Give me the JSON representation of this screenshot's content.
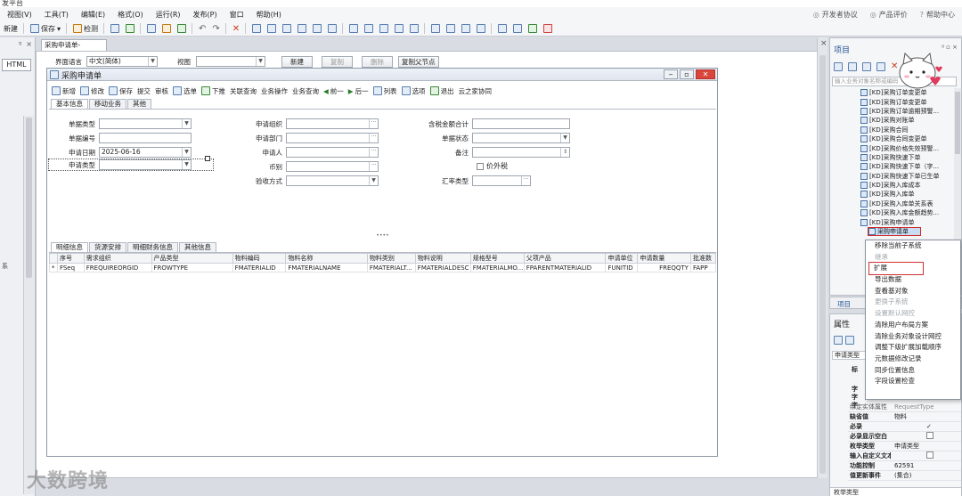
{
  "window": {
    "title": "发平台"
  },
  "menubar": {
    "items": [
      "视图(V)",
      "工具(T)",
      "编辑(E)",
      "格式(O)",
      "运行(R)",
      "发布(P)",
      "窗口",
      "帮助(H)"
    ],
    "right": [
      "开发者协议",
      "产品评价",
      "帮助中心"
    ]
  },
  "toolbar": {
    "new_label": "新建",
    "save_label": "保存",
    "check_label": "检测"
  },
  "leftpanel": {
    "pin": "ᵍ",
    "close": "×",
    "html_tab": "HTML",
    "side_label": "系"
  },
  "doc": {
    "tab_label": "采购申请单-_Default",
    "lang_label": "界面语言",
    "lang_value": "中文(简体)",
    "view_label": "视图",
    "view_value": "",
    "buttons": [
      "新建",
      "复制",
      "删除",
      "复制父节点"
    ]
  },
  "designer": {
    "title": "采购申请单",
    "toolbar": [
      "新增",
      "修改",
      "保存",
      "提交",
      "审核",
      "选单",
      "下推",
      "关联查询",
      "业务操作",
      "业务查询",
      "前一",
      "后一",
      "列表",
      "选项",
      "退出",
      "云之家协同"
    ],
    "head_tabs": [
      "基本信息",
      "移动业务",
      "其他"
    ],
    "col1": [
      {
        "label": "单据类型",
        "value": ""
      },
      {
        "label": "单据编号",
        "value": ""
      },
      {
        "label": "申请日期",
        "value": "2025-06-16"
      },
      {
        "label": "申请类型",
        "value": ""
      }
    ],
    "col2": [
      {
        "label": "申请组织",
        "value": ""
      },
      {
        "label": "申请部门",
        "value": ""
      },
      {
        "label": "申请人",
        "value": ""
      },
      {
        "label": "币别",
        "value": ""
      },
      {
        "label": "验收方式",
        "value": ""
      }
    ],
    "col3": [
      {
        "label": "含税金额合计",
        "value": ""
      },
      {
        "label": "单据状态",
        "value": ""
      },
      {
        "label": "备注",
        "value": ""
      },
      {
        "label": "价外税",
        "value": ""
      },
      {
        "label": "汇率类型",
        "value": ""
      }
    ],
    "splitter": "••••",
    "detail_tabs": [
      "明细信息",
      "货源安排",
      "明细财务信息",
      "其他信息"
    ],
    "grid": {
      "headers": [
        "序号",
        "需求组织",
        "产品类型",
        "物料编码",
        "物料名称",
        "物料类别",
        "物料说明",
        "规格型号",
        "父项产品",
        "申请单位",
        "申请数量",
        "批准数"
      ],
      "row_marker": "*",
      "row": [
        "FSeq",
        "FREQUIREORGID",
        "FROWTYPE",
        "FMATERIALID",
        "FMATERIALNAME",
        "FMATERIALT...",
        "FMATERIALDESC",
        "FMATERIALMO...",
        "FPARENTMATERIALID",
        "FUNITID",
        "FREQQTY",
        "FAPP"
      ]
    }
  },
  "project": {
    "title": "项目",
    "pins": "ᵍ ▫ ×",
    "search_placeholder": "输入业务对象名称或编码",
    "tree": [
      "[KD]采购订单变更单",
      "[KD]采购订单变更单",
      "[KD]采购订单逾期预警...",
      "[KD]采购对账单",
      "[KD]采购合同",
      "[KD]采购合同变更单",
      "[KD]采购价格失效预警...",
      "[KD]采购快速下单",
      "[KD]采购快速下单（字...",
      "[KD]采购快速下单已生单",
      "[KD]采购入库成本",
      "[KD]采购入库单",
      "[KD]采购入库单关系表",
      "[KD]采购入库金额趋势...",
      "[KD]采购申请单",
      "采购申请单"
    ],
    "tab_label": "项目"
  },
  "context_menu": [
    {
      "label": "移除当前子系统",
      "enabled": true
    },
    {
      "label": "继承",
      "enabled": false
    },
    {
      "label": "扩展",
      "enabled": true,
      "highlight": true
    },
    {
      "label": "导出数据",
      "enabled": true
    },
    {
      "label": "查看基对象",
      "enabled": true
    },
    {
      "label": "更换子系统",
      "enabled": false
    },
    {
      "label": "设置默认网控",
      "enabled": false
    },
    {
      "label": "清除用户布局方案",
      "enabled": true
    },
    {
      "label": "清除业务对象设计网控",
      "enabled": true
    },
    {
      "label": "调整下级扩展加载顺序",
      "enabled": true
    },
    {
      "label": "元数据修改记录",
      "enabled": true
    },
    {
      "label": "同步位置信息",
      "enabled": true
    },
    {
      "label": "字段设置检查",
      "enabled": true
    }
  ],
  "properties": {
    "title": "属性",
    "type_value": "申请类型",
    "rows": [
      {
        "k": "绑定实体属性",
        "v": "RequestType",
        "grey": true
      },
      {
        "k": "缺省值",
        "v": "物料"
      },
      {
        "k": "必录",
        "v": "✓",
        "check": true,
        "checked": true
      },
      {
        "k": "必录显示空白",
        "v": "",
        "check": true,
        "checked": false
      },
      {
        "k": "枚举类型",
        "v": "申请类型"
      },
      {
        "k": "输入自定义文本",
        "v": "",
        "check": true,
        "checked": false
      },
      {
        "k": "功能控制",
        "v": "62591"
      },
      {
        "k": "值更新事件",
        "v": "(集合)"
      }
    ],
    "side_keys": [
      "标",
      "字",
      "字",
      "字"
    ],
    "footer": "枚举类型"
  },
  "watermark": "大数跨境",
  "colors": {
    "accent": "#1d4f91",
    "highlight_red": "#d42f2f",
    "close_red": "#d9463c"
  }
}
